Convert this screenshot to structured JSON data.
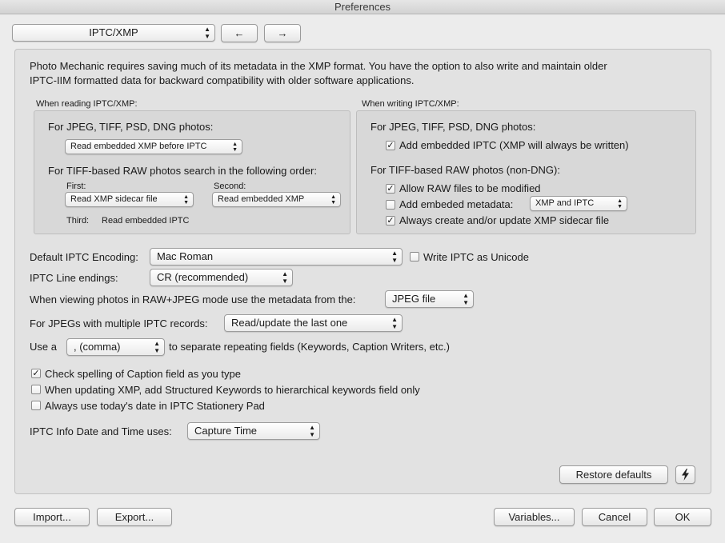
{
  "window": {
    "title": "Preferences"
  },
  "toolbar": {
    "section": "IPTC/XMP",
    "back": "←",
    "forward": "→"
  },
  "intro": {
    "line1": "Photo Mechanic requires saving much of its metadata in the XMP format.  You have the option to also write and maintain older",
    "line2": "IPTC-IIM formatted data for backward compatibility with older software applications."
  },
  "reading": {
    "title": "When reading IPTC/XMP:",
    "jpeg_label": "For JPEG, TIFF, PSD, DNG photos:",
    "jpeg_value": "Read embedded XMP before IPTC",
    "raw_label": "For TIFF-based RAW photos search in the following order:",
    "first_label": "First:",
    "first_value": "Read XMP sidecar file",
    "second_label": "Second:",
    "second_value": "Read embedded XMP",
    "third_label": "Third:",
    "third_value": "Read embedded IPTC"
  },
  "writing": {
    "title": "When writing IPTC/XMP:",
    "jpeg_label": "For JPEG, TIFF, PSD, DNG photos:",
    "add_iptc": "Add embedded IPTC (XMP will always be written)",
    "raw_label": "For TIFF-based RAW photos (non-DNG):",
    "allow_raw": "Allow RAW files to be modified",
    "add_meta": "Add embeded metadata:",
    "add_meta_value": "XMP and IPTC",
    "always_sidecar": "Always create and/or update XMP sidecar file"
  },
  "checks": {
    "add_iptc": true,
    "allow_raw": true,
    "add_meta": false,
    "always_sidecar": true,
    "write_unicode": false,
    "spell": true,
    "structured": false,
    "today": false
  },
  "encoding": {
    "label": "Default IPTC Encoding:",
    "value": "Mac Roman",
    "unicode_label": "Write IPTC as Unicode"
  },
  "line_endings": {
    "label": "IPTC Line endings:",
    "value": "CR (recommended)"
  },
  "raw_jpeg": {
    "label": "When viewing photos in RAW+JPEG mode use the metadata from the:",
    "value": "JPEG file"
  },
  "multi": {
    "label": "For JPEGs with multiple IPTC records:",
    "value": "Read/update the last one"
  },
  "sep": {
    "prefix": "Use a",
    "value": ", (comma)",
    "suffix": "to separate repeating fields (Keywords, Caption Writers, etc.)"
  },
  "options": {
    "spell": "Check spelling of Caption field as you type",
    "structured": "When updating XMP, add Structured Keywords to hierarchical keywords field only",
    "today": "Always use today's date in IPTC Stationery Pad"
  },
  "datetime": {
    "label": "IPTC Info Date and Time uses:",
    "value": "Capture Time"
  },
  "restore": {
    "label": "Restore defaults",
    "icon": "lightning-icon"
  },
  "footer": {
    "import": "Import...",
    "export": "Export...",
    "variables": "Variables...",
    "cancel": "Cancel",
    "ok": "OK"
  }
}
